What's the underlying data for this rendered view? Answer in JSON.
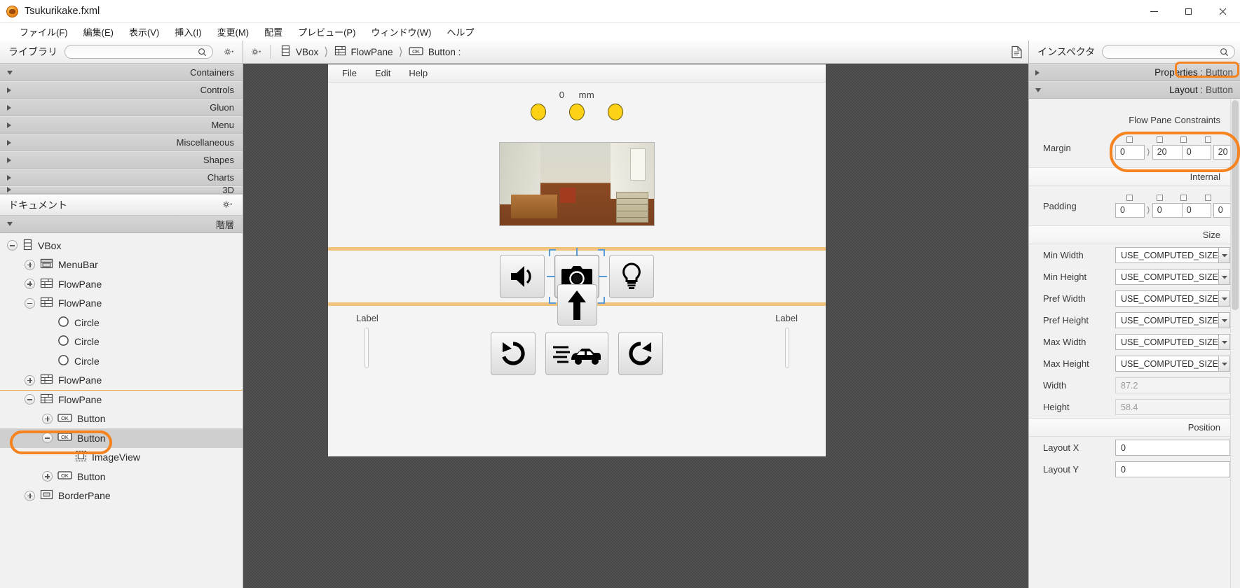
{
  "window": {
    "title": "Tsukurikake.fxml",
    "app_icon": "scenebuilder-icon",
    "minimize": "minimize-icon",
    "maximize": "maximize-icon",
    "close": "close-icon"
  },
  "menubar": {
    "items": [
      {
        "label": "ファイル(F)"
      },
      {
        "label": "編集(E)"
      },
      {
        "label": "表示(V)"
      },
      {
        "label": "挿入(I)"
      },
      {
        "label": "変更(M)"
      },
      {
        "label": "配置"
      },
      {
        "label": "プレビュー(P)"
      },
      {
        "label": "ウィンドウ(W)"
      },
      {
        "label": "ヘルプ"
      }
    ]
  },
  "library": {
    "title": "ライブラリ",
    "search_placeholder": "",
    "search_value": "",
    "search_icon": "search-icon",
    "gear_icon": "gear-icon",
    "categories": [
      {
        "label": "Containers",
        "expanded": true
      },
      {
        "label": "Controls",
        "expanded": false
      },
      {
        "label": "Gluon",
        "expanded": false
      },
      {
        "label": "Menu",
        "expanded": false
      },
      {
        "label": "Miscellaneous",
        "expanded": false
      },
      {
        "label": "Shapes",
        "expanded": false
      },
      {
        "label": "Charts",
        "expanded": false
      },
      {
        "label": "3D",
        "expanded": false
      }
    ]
  },
  "document": {
    "title": "ドキュメント",
    "gear_icon": "gear-icon",
    "subhead_label": "階層",
    "tree": [
      {
        "label": "VBox",
        "indent": 0,
        "state": "minus",
        "icon": "vbox-icon",
        "selected": false
      },
      {
        "label": "MenuBar",
        "indent": 1,
        "state": "plus",
        "icon": "menubar-icon",
        "selected": false
      },
      {
        "label": "FlowPane",
        "indent": 1,
        "state": "plus",
        "icon": "flowpane-icon",
        "selected": false
      },
      {
        "label": "FlowPane",
        "indent": 1,
        "state": "minus",
        "icon": "flowpane-icon",
        "selected": false
      },
      {
        "label": "Circle",
        "indent": 2,
        "state": "none",
        "icon": "circle-icon",
        "selected": false
      },
      {
        "label": "Circle",
        "indent": 2,
        "state": "none",
        "icon": "circle-icon",
        "selected": false
      },
      {
        "label": "Circle",
        "indent": 2,
        "state": "none",
        "icon": "circle-icon",
        "selected": false
      },
      {
        "label": "FlowPane",
        "indent": 1,
        "state": "plus",
        "icon": "flowpane-icon",
        "selected": false
      },
      {
        "label": "FlowPane",
        "indent": 1,
        "state": "minus",
        "icon": "flowpane-icon",
        "selected": false
      },
      {
        "label": "Button",
        "indent": 2,
        "state": "plus",
        "icon": "button-ok-icon",
        "selected": false
      },
      {
        "label": "Button",
        "indent": 2,
        "state": "minus",
        "icon": "button-ok-icon",
        "selected": true
      },
      {
        "label": "ImageView",
        "indent": 3,
        "state": "none",
        "icon": "imageview-icon",
        "selected": false
      },
      {
        "label": "Button",
        "indent": 2,
        "state": "plus",
        "icon": "button-ok-icon",
        "selected": false
      },
      {
        "label": "BorderPane",
        "indent": 1,
        "state": "plus",
        "icon": "borderpane-icon",
        "selected": false
      }
    ]
  },
  "breadcrumb": {
    "gear_icon": "gear-icon",
    "items": [
      {
        "label": "VBox",
        "icon": "vbox-icon"
      },
      {
        "label": "FlowPane",
        "icon": "flowpane-icon"
      },
      {
        "label": "Button :",
        "icon": "button-ok-icon"
      }
    ],
    "doc_icon": "document-icon"
  },
  "preview": {
    "menu": [
      {
        "label": "File"
      },
      {
        "label": "Edit"
      },
      {
        "label": "Help"
      }
    ],
    "measure_value": "0",
    "measure_unit": "mm",
    "circles": [
      "circle-1",
      "circle-2",
      "circle-3"
    ],
    "circle_color": "#fcd116",
    "image": "room-photo",
    "toolbar_buttons": [
      {
        "icon": "speaker-icon",
        "selected": false
      },
      {
        "icon": "camera-icon",
        "selected": true
      },
      {
        "icon": "lightbulb-icon",
        "selected": false
      }
    ],
    "labels": [
      {
        "text": "Label"
      },
      {
        "text": "Label"
      }
    ],
    "arrow_button": {
      "icon": "arrow-up-icon"
    },
    "bottom_buttons": [
      {
        "icon": "rotate-left-icon"
      },
      {
        "icon": "car-icon"
      },
      {
        "icon": "rotate-right-icon"
      }
    ]
  },
  "inspector": {
    "title": "インスペクタ",
    "search_value": "",
    "search_icon": "search-icon",
    "gear_icon": "gear-icon",
    "accordion": [
      {
        "label_main": "Properties",
        "label_sub": "Button",
        "expanded": false,
        "highlighted": false
      },
      {
        "label_main": "Layout",
        "label_sub": "Button",
        "expanded": true,
        "highlighted": true
      }
    ],
    "sections": {
      "flow_pane_constraints": {
        "title": "Flow Pane Constraints",
        "margin": {
          "label": "Margin",
          "values": [
            "0",
            "20",
            "0",
            "20"
          ],
          "checkboxes": [
            false,
            false,
            false,
            false
          ]
        }
      },
      "internal": {
        "title": "Internal",
        "padding": {
          "label": "Padding",
          "values": [
            "0",
            "0",
            "0",
            "0"
          ],
          "checkboxes": [
            false,
            false,
            false,
            false
          ]
        }
      },
      "size": {
        "title": "Size",
        "fields": [
          {
            "label": "Min Width",
            "value": "USE_COMPUTED_SIZE",
            "dropdown": true,
            "disabled": false
          },
          {
            "label": "Min Height",
            "value": "USE_COMPUTED_SIZE",
            "dropdown": true,
            "disabled": false
          },
          {
            "label": "Pref Width",
            "value": "USE_COMPUTED_SIZE",
            "dropdown": true,
            "disabled": false
          },
          {
            "label": "Pref Height",
            "value": "USE_COMPUTED_SIZE",
            "dropdown": true,
            "disabled": false
          },
          {
            "label": "Max Width",
            "value": "USE_COMPUTED_SIZE",
            "dropdown": true,
            "disabled": false
          },
          {
            "label": "Max Height",
            "value": "USE_COMPUTED_SIZE",
            "dropdown": true,
            "disabled": false
          },
          {
            "label": "Width",
            "value": "87.2",
            "dropdown": false,
            "disabled": true
          },
          {
            "label": "Height",
            "value": "58.4",
            "dropdown": false,
            "disabled": true
          }
        ]
      },
      "position": {
        "title": "Position",
        "fields": [
          {
            "label": "Layout X",
            "value": "0",
            "dropdown": false,
            "disabled": false
          },
          {
            "label": "Layout Y",
            "value": "0",
            "dropdown": false,
            "disabled": false
          }
        ]
      }
    }
  },
  "colors": {
    "annotation": "#f5831f",
    "selection_band": "#f0c27a",
    "handle": "#5b9bd5"
  }
}
